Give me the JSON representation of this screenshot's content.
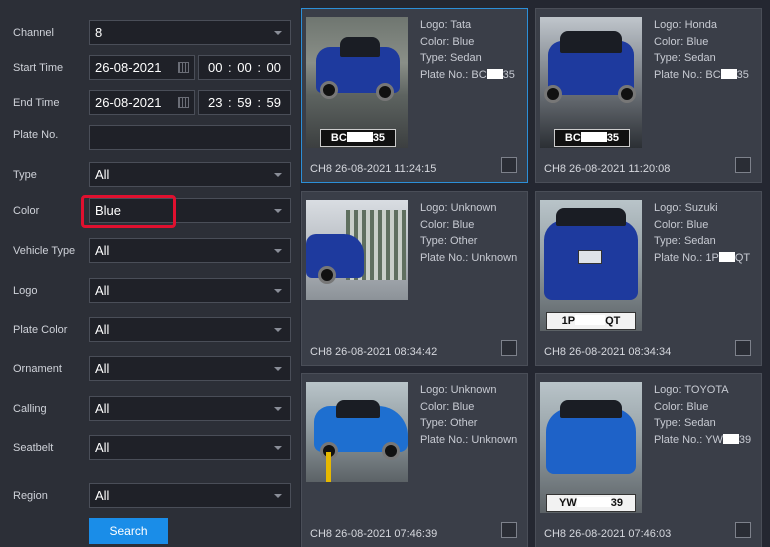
{
  "filters": {
    "channel": {
      "label": "Channel",
      "value": "8"
    },
    "start_time": {
      "label": "Start Time",
      "date": "26-08-2021",
      "time": "00 : 00 : 00"
    },
    "end_time": {
      "label": "End Time",
      "date": "26-08-2021",
      "time": "23 : 59 : 59"
    },
    "plate_no": {
      "label": "Plate No.",
      "value": ""
    },
    "type": {
      "label": "Type",
      "value": "All"
    },
    "color": {
      "label": "Color",
      "value": "Blue"
    },
    "vehicle_type": {
      "label": "Vehicle Type",
      "value": "All"
    },
    "logo": {
      "label": "Logo",
      "value": "All"
    },
    "plate_color": {
      "label": "Plate Color",
      "value": "All"
    },
    "ornament": {
      "label": "Ornament",
      "value": "All"
    },
    "calling": {
      "label": "Calling",
      "value": "All"
    },
    "seatbelt": {
      "label": "Seatbelt",
      "value": "All"
    },
    "region": {
      "label": "Region",
      "value": "All"
    },
    "search_label": "Search"
  },
  "results": [
    {
      "logo": "Logo: Tata",
      "color": "Color: Blue",
      "type": "Type: Sedan",
      "plate_pre": "Plate No.: BC",
      "plate_post": "35",
      "plate_img_pre": "BC",
      "plate_img_post": "35",
      "footer": "CH8 26-08-2021 11:24:15"
    },
    {
      "logo": "Logo: Honda",
      "color": "Color: Blue",
      "type": "Type: Sedan",
      "plate_pre": "Plate No.: BC",
      "plate_post": "35",
      "plate_img_pre": "BC",
      "plate_img_post": "35",
      "footer": "CH8 26-08-2021 11:20:08"
    },
    {
      "logo": "Logo: Unknown",
      "color": "Color: Blue",
      "type": "Type: Other",
      "plate": "Plate No.: Unknown",
      "footer": "CH8 26-08-2021 08:34:42"
    },
    {
      "logo": "Logo: Suzuki",
      "color": "Color: Blue",
      "type": "Type: Sedan",
      "plate_pre": "Plate No.: 1P",
      "plate_post": "QT",
      "plate_img_pre": "1P",
      "plate_img_post": "QT",
      "footer": "CH8 26-08-2021 08:34:34"
    },
    {
      "logo": "Logo: Unknown",
      "color": "Color: Blue",
      "type": "Type: Other",
      "plate": "Plate No.: Unknown",
      "footer": "CH8 26-08-2021 07:46:39"
    },
    {
      "logo": "Logo: TOYOTA",
      "color": "Color: Blue",
      "type": "Type: Sedan",
      "plate_pre": "Plate No.: YW",
      "plate_post": "39",
      "plate_img_pre": "YW",
      "plate_img_post": "39",
      "footer": "CH8 26-08-2021 07:46:03"
    }
  ],
  "colors": {
    "accent": "#1a8de8",
    "highlight": "#e0102f",
    "selected_border": "#2c8fd8"
  }
}
